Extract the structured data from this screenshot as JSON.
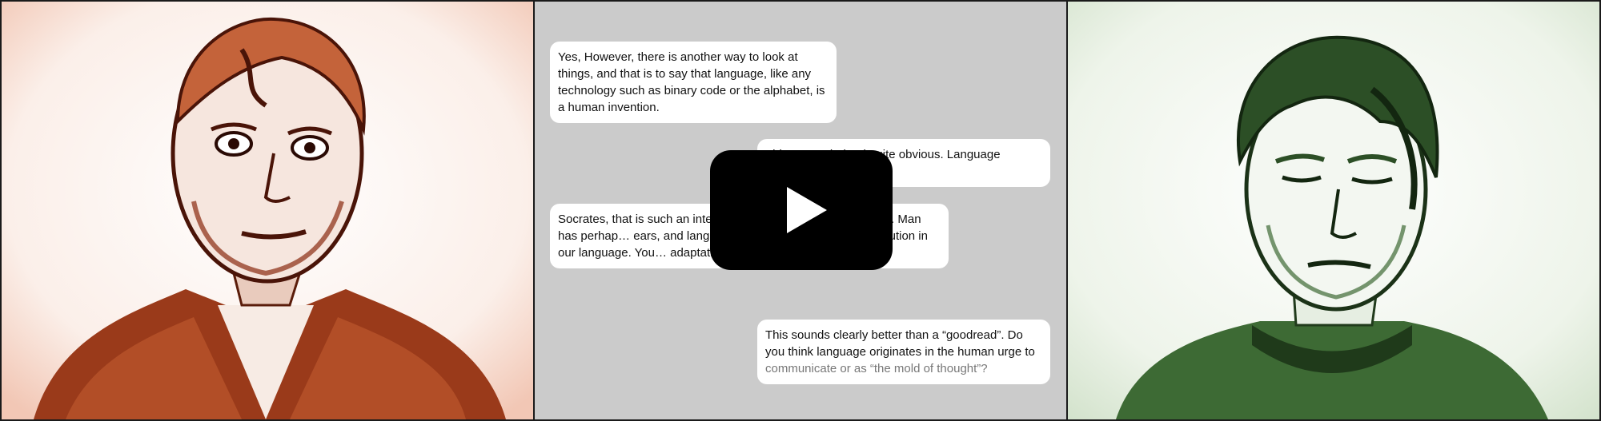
{
  "video": {
    "play_button_icon": "play-icon"
  },
  "panels": {
    "left_portrait": {
      "icon": "portrait-illustration-red"
    },
    "right_portrait": {
      "icon": "portrait-illustration-green"
    }
  },
  "chat": {
    "messages": [
      {
        "side": "left",
        "text": "Yes, However, there is another way to look at things, and that is to say that language, like any technology such as binary code or the alphabet, is a human invention."
      },
      {
        "side": "right",
        "text": "This seems indeed quite obvious. Language capacity … turally."
      },
      {
        "side": "left",
        "text": "Socrates, that is such an inter… n, and … re is not one answer. Man has perhap… ears, and language for 50 thousand. N… of evolution in our language. You… adaptation to the environment."
      },
      {
        "side": "right",
        "text_main": "This sounds clearly better than a “goodread”. Do you think language originates in the human urge to",
        "text_faded": "communicate or as “the mold of thought”?"
      }
    ]
  },
  "colors": {
    "left_tint": "#8a2a10",
    "right_tint": "#2f5a2a",
    "chat_bg": "#cbcbcb",
    "bubble_bg": "#ffffff"
  }
}
